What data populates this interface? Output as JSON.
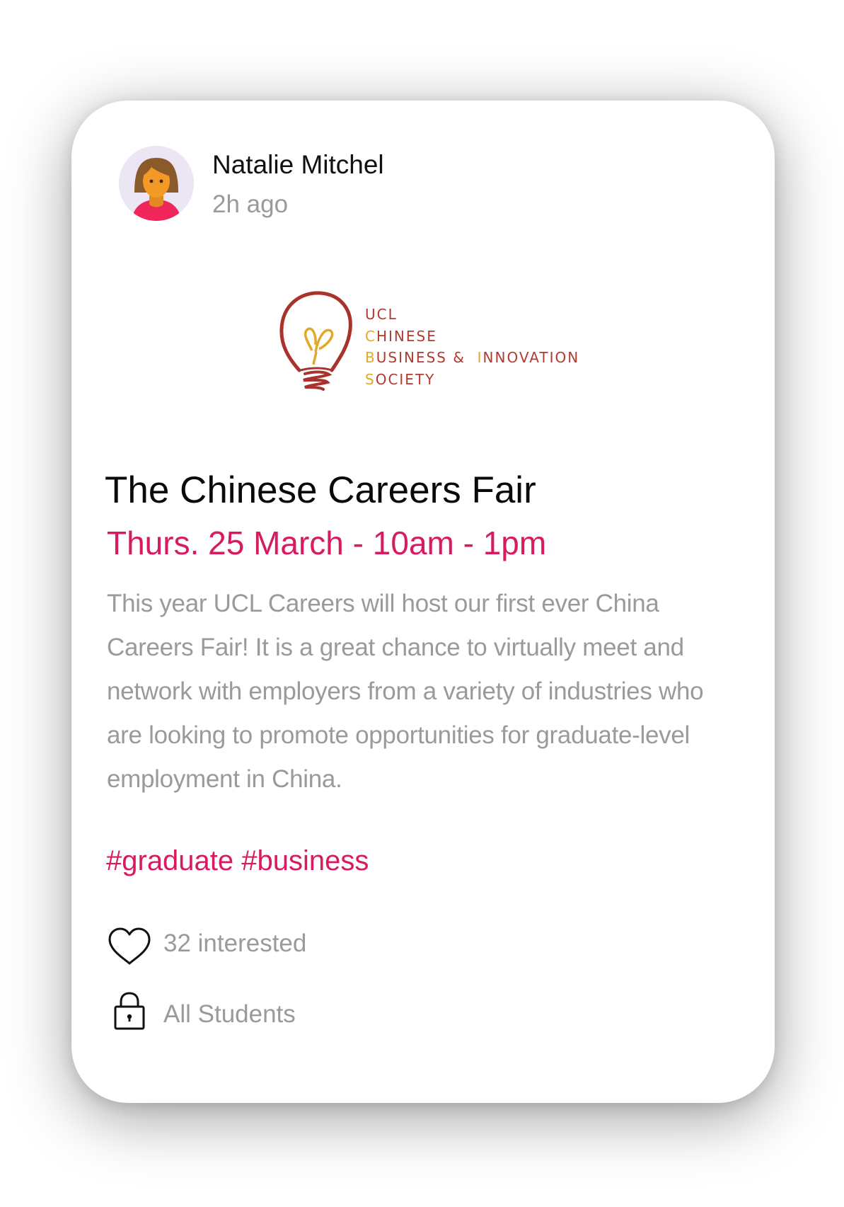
{
  "post": {
    "author": {
      "name": "Natalie Mitchel",
      "time": "2h ago",
      "avatar_icon": "woman-avatar-icon"
    },
    "logo": {
      "lines": [
        {
          "initial": "",
          "rest": "UCL"
        },
        {
          "initial": "C",
          "rest": "HINESE"
        },
        {
          "initial": "B",
          "rest": "USINESS &"
        },
        {
          "initial": "I",
          "rest": "NNOVATION"
        },
        {
          "initial": "S",
          "rest": "OCIETY"
        }
      ],
      "colors": {
        "primary": "#b23a31",
        "accent": "#e0a92a"
      }
    },
    "title": "The Chinese Careers Fair",
    "date": "Thurs. 25 March - 10am - 1pm",
    "description": "This year UCL Careers will host our first ever China Careers Fair! It is a great chance to virtually meet and network with employers from a variety of industries who are looking to promote opportunities for graduate-level employment in China.",
    "tags": "#graduate #business",
    "interest": {
      "icon": "heart-icon",
      "label": "32 interested"
    },
    "audience": {
      "icon": "lock-icon",
      "label": "All Students"
    }
  },
  "colors": {
    "accent": "#d81b60",
    "muted_text": "#9a9a9a",
    "primary_text": "#0a0a0a"
  }
}
